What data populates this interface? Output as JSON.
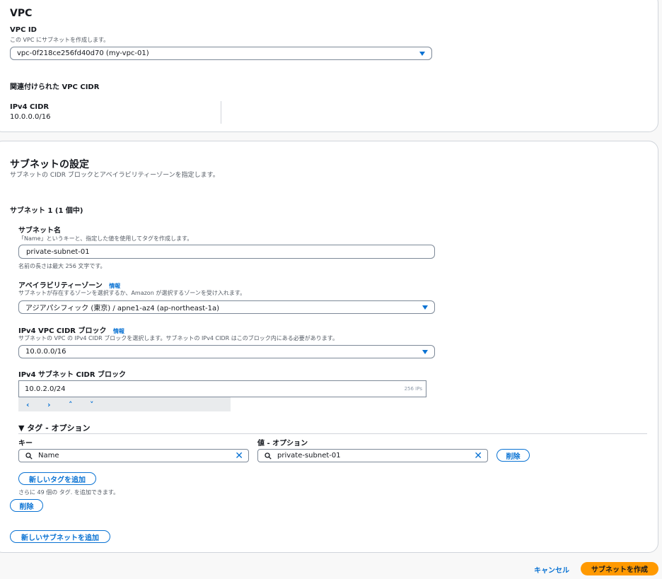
{
  "vpc_section": {
    "title": "VPC",
    "vpc_id_label": "VPC ID",
    "vpc_id_desc": "この VPC にサブネットを作成します。",
    "vpc_id_value": "vpc-0f218ce256fd40d70 (my-vpc-01)",
    "assoc_cidr_heading": "関連付けられた VPC CIDR",
    "ipv4_cidr_label": "IPv4 CIDR",
    "ipv4_cidr_value": "10.0.0.0/16"
  },
  "subnet_section": {
    "title": "サブネットの設定",
    "desc": "サブネットの CIDR ブロックとアベイラビリティーゾーンを指定します。",
    "subnet_heading": "サブネット 1 (1 個中)",
    "name_label": "サブネット名",
    "name_desc": "「Name」というキーと、指定した値を使用してタグを作成します。",
    "name_value": "private-subnet-01",
    "name_hint": "名前の長さは最大 256 文字です。",
    "az_label": "アベイラビリティーゾーン",
    "info_link": "情報",
    "az_desc": "サブネットが存在するゾーンを選択するか、Amazon が選択するゾーンを受け入れます。",
    "az_value": "アジアパシフィック (東京) / apne1-az4 (ap-northeast-1a)",
    "vpc_cidr_label": "IPv4 VPC CIDR ブロック",
    "vpc_cidr_desc": "サブネットの VPC の IPv4 CIDR ブロックを選択します。サブネットの IPv4 CIDR はこのブロック内にある必要があります。",
    "vpc_cidr_value": "10.0.0.0/16",
    "subnet_cidr_label": "IPv4 サブネット CIDR ブロック",
    "subnet_cidr_value": "10.0.2.0/24",
    "subnet_cidr_count": "256 IPs",
    "stepper": [
      "‹",
      "›",
      "˄",
      "˅"
    ],
    "tags_toggle": "▼ タグ - オプション",
    "key_label": "キー",
    "value_label": "値 - オプション",
    "tag_key": "Name",
    "tag_value": "private-subnet-01",
    "remove_tag": "削除",
    "add_tag": "新しいタグを追加",
    "tag_limit": "さらに 49 個の タグ. を追加できます。",
    "remove_subnet": "削除",
    "add_subnet": "新しいサブネットを追加"
  },
  "footer": {
    "cancel": "キャンセル",
    "create": "サブネットを作成"
  },
  "colors": {
    "link": "#0972d3",
    "primary": "#ff9900"
  }
}
